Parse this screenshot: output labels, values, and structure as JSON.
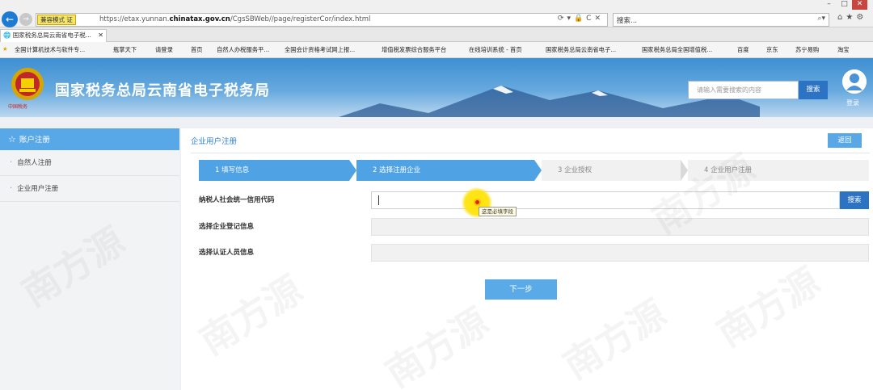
{
  "browser": {
    "compat_label": "兼容模式 证",
    "url_prefix": "https://etax.yunnan.",
    "url_domain": "chinatax.gov.cn",
    "url_suffix": "/CgsSBWeb//page/registerCor/index.html",
    "search_placeholder": "搜索...",
    "tab_title": "国家税务总局云南省电子税...",
    "favorites": [
      "全国计算机技术与软件专...",
      "瓶掌天下",
      "请登录",
      "首页",
      "自然人办税服务平...",
      "全国会计资格考试网上报...",
      "增值税发票综合服务平台",
      "在线培训系统 - 首页",
      "国家税务总局云南省电子...",
      "国家税务总局全国增值税...",
      "百度",
      "京东",
      "苏宁易购",
      "淘宝"
    ]
  },
  "header": {
    "site_title": "国家税务总局云南省电子税务局",
    "emblem_text": "中国税务",
    "search_placeholder": "请输入需要搜索的内容",
    "search_button": "搜索",
    "login_label": "登录"
  },
  "sidebar": {
    "header": "账户注册",
    "items": [
      {
        "label": "自然人注册"
      },
      {
        "label": "企业用户注册"
      }
    ]
  },
  "main": {
    "title": "企业用户注册",
    "back_button": "返回",
    "steps": [
      {
        "label": "1  填写信息"
      },
      {
        "label": "2  选择注册企业"
      },
      {
        "label": "3  企业授权"
      },
      {
        "label": "4  企业用户注册"
      }
    ],
    "fields": [
      {
        "label": "纳税人社会统一信用代码"
      },
      {
        "label": "选择企业登记信息"
      },
      {
        "label": "选择认证人员信息"
      }
    ],
    "field_search_button": "搜索",
    "tooltip": "这是必填字段",
    "next_button": "下一步"
  },
  "watermark": "南方源",
  "colors": {
    "primary": "#58a7e6",
    "dark_blue": "#2d73c4",
    "header_blue": "#3f8fd2"
  }
}
